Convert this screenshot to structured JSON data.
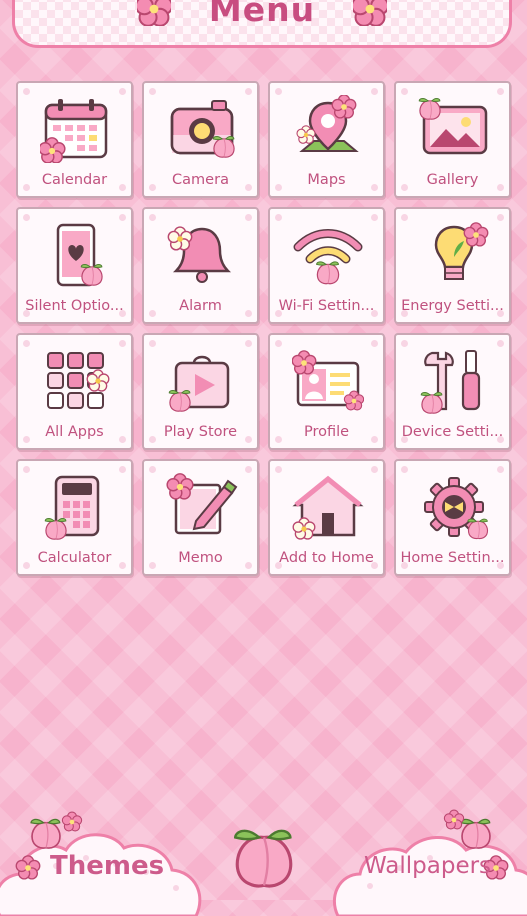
{
  "header": {
    "title": "Menu"
  },
  "apps": [
    {
      "label": "Calendar",
      "icon": "calendar-icon"
    },
    {
      "label": "Camera",
      "icon": "camera-icon"
    },
    {
      "label": "Maps",
      "icon": "map-pin-icon"
    },
    {
      "label": "Gallery",
      "icon": "gallery-icon"
    },
    {
      "label": "Silent Optio...",
      "icon": "phone-silent-icon"
    },
    {
      "label": "Alarm",
      "icon": "bell-icon"
    },
    {
      "label": "Wi-Fi Settin...",
      "icon": "wifi-icon"
    },
    {
      "label": "Energy Setti...",
      "icon": "lightbulb-icon"
    },
    {
      "label": "All Apps",
      "icon": "apps-grid-icon"
    },
    {
      "label": "Play Store",
      "icon": "play-store-icon"
    },
    {
      "label": "Profile",
      "icon": "profile-card-icon"
    },
    {
      "label": "Device Setti...",
      "icon": "wrench-screwdriver-icon"
    },
    {
      "label": "Calculator",
      "icon": "calculator-icon"
    },
    {
      "label": "Memo",
      "icon": "memo-pencil-icon"
    },
    {
      "label": "Add to Home",
      "icon": "house-icon"
    },
    {
      "label": "Home Settin...",
      "icon": "gear-bow-icon"
    }
  ],
  "bottom": {
    "themes_label": "Themes",
    "wallpapers_label": "Wallpapers"
  },
  "colors": {
    "accent": "#c84d80",
    "pink": "#f7b3cd",
    "tile_bg": "#fff9fc",
    "border": "#c9a7b4"
  }
}
